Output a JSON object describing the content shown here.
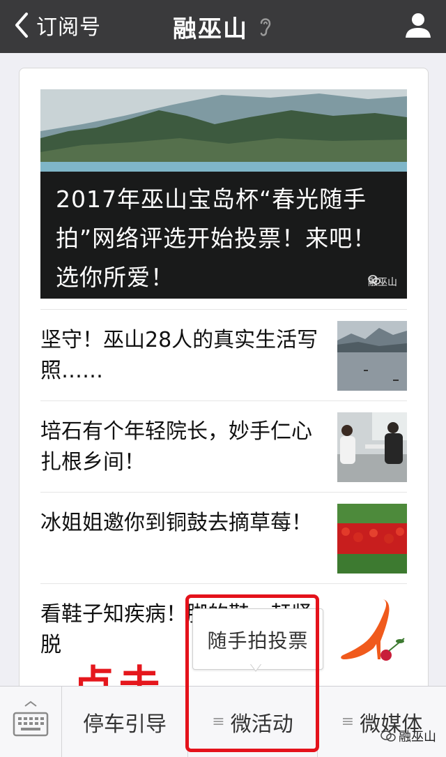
{
  "nav": {
    "back_label": "订阅号",
    "title": "融巫山"
  },
  "hero": {
    "title": "2017年巫山宝岛杯“春光随手拍”网络评选开始投票！来吧！选你所爱！",
    "watermark": "融巫山"
  },
  "articles": [
    {
      "title": "坚守！巫山28人的真实生活写照……",
      "thumb": "lake-mountain-image"
    },
    {
      "title": "培石有个年轻院长，妙手仁心扎根乡间！",
      "thumb": "doctor-office-image"
    },
    {
      "title": "冰姐姐邀你到铜鼓去摘草莓！",
      "thumb": "strawberries-image"
    },
    {
      "title": "看鞋子知疾病！脚的鞋，赶紧脱",
      "thumb": "red-high-heel-image"
    }
  ],
  "popup": {
    "label": "随手拍投票"
  },
  "annotation": {
    "text": "点击",
    "color": "#e5171d"
  },
  "bottom_menu": [
    {
      "label": "停车引导"
    },
    {
      "label": "微活动"
    },
    {
      "label": "微媒体"
    }
  ],
  "corner_watermark": "融巫山",
  "colors": {
    "topbar": "#3a3a3c",
    "background": "#efeff4",
    "highlight": "#e4121b"
  }
}
